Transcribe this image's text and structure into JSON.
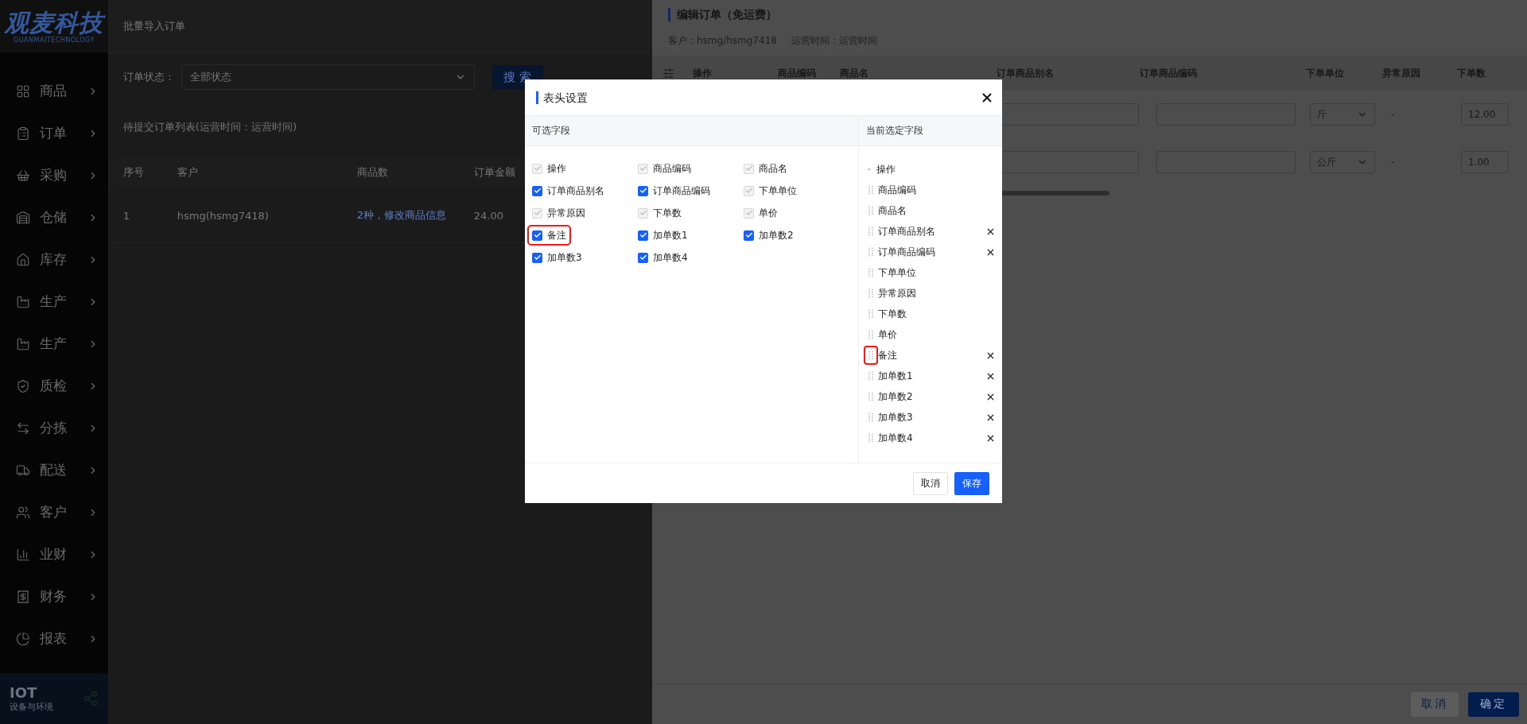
{
  "sidebar": {
    "logo": "观麦科技",
    "logo_sub": "GUANMAITECHNOLOGY",
    "items": [
      {
        "label": "商品"
      },
      {
        "label": "订单"
      },
      {
        "label": "采购"
      },
      {
        "label": "仓储"
      },
      {
        "label": "库存"
      },
      {
        "label": "生产"
      },
      {
        "label": "生产"
      },
      {
        "label": "质检"
      },
      {
        "label": "分拣"
      },
      {
        "label": "配送"
      },
      {
        "label": "客户"
      },
      {
        "label": "业财"
      },
      {
        "label": "财务"
      },
      {
        "label": "报表"
      }
    ],
    "promo": {
      "title": "IOT",
      "subtitle": "设备与环境"
    }
  },
  "page": {
    "title": "批量导入订单",
    "filter": {
      "label": "订单状态：",
      "value": "全部状态",
      "button": "搜 索"
    },
    "list_title": "待提交订单列表(运营时间：运营时间)",
    "table": {
      "columns": [
        "序号",
        "客户",
        "商品数",
        "订单金额"
      ],
      "rows": [
        {
          "index": "1",
          "customer": "hsmg(hsmg7418)",
          "items_link": "2种，修改商品信息",
          "amount": "24.00"
        }
      ]
    }
  },
  "drawer": {
    "title": "编辑订单（免运费）",
    "customer": "客户：hsmg/hsmg7418",
    "time": "运营时间：运营时间",
    "columns": [
      "操作",
      "商品编码",
      "商品名",
      "订单商品别名",
      "订单商品编码",
      "下单单位",
      "异常原因",
      "下单数"
    ],
    "rows": [
      {
        "unit": "斤",
        "reason": "-",
        "quantity": "12.00"
      },
      {
        "unit": "公斤",
        "reason": "-",
        "quantity": "1.00"
      }
    ],
    "buttons": [
      {
        "label": "取消",
        "kind": "secondary"
      },
      {
        "label": "确定",
        "kind": "primary"
      }
    ]
  },
  "modal": {
    "title": "表头设置",
    "available_title": "可选字段",
    "selected_title": "当前选定字段",
    "available": [
      {
        "label": "操作",
        "checked": true,
        "disabled": true,
        "highlighted": false
      },
      {
        "label": "商品编码",
        "checked": true,
        "disabled": true,
        "highlighted": false
      },
      {
        "label": "商品名",
        "checked": true,
        "disabled": true,
        "highlighted": false
      },
      {
        "label": "订单商品别名",
        "checked": true,
        "disabled": false,
        "highlighted": false
      },
      {
        "label": "订单商品编码",
        "checked": true,
        "disabled": false,
        "highlighted": false
      },
      {
        "label": "下单单位",
        "checked": true,
        "disabled": true,
        "highlighted": false
      },
      {
        "label": "异常原因",
        "checked": true,
        "disabled": true,
        "highlighted": false
      },
      {
        "label": "下单数",
        "checked": true,
        "disabled": true,
        "highlighted": false
      },
      {
        "label": "单价",
        "checked": true,
        "disabled": true,
        "highlighted": false
      },
      {
        "label": "备注",
        "checked": true,
        "disabled": false,
        "highlighted": true
      },
      {
        "label": "加单数1",
        "checked": true,
        "disabled": false,
        "highlighted": false
      },
      {
        "label": "加单数2",
        "checked": true,
        "disabled": false,
        "highlighted": false
      },
      {
        "label": "加单数3",
        "checked": true,
        "disabled": false,
        "highlighted": false
      },
      {
        "label": "加单数4",
        "checked": true,
        "disabled": false,
        "highlighted": false
      }
    ],
    "selected": [
      {
        "label": "操作",
        "draggable": false,
        "removable": false,
        "highlighted": false
      },
      {
        "label": "商品编码",
        "draggable": true,
        "removable": false,
        "highlighted": false
      },
      {
        "label": "商品名",
        "draggable": true,
        "removable": false,
        "highlighted": false
      },
      {
        "label": "订单商品别名",
        "draggable": true,
        "removable": true,
        "highlighted": false
      },
      {
        "label": "订单商品编码",
        "draggable": true,
        "removable": true,
        "highlighted": false
      },
      {
        "label": "下单单位",
        "draggable": true,
        "removable": false,
        "highlighted": false
      },
      {
        "label": "异常原因",
        "draggable": true,
        "removable": false,
        "highlighted": false
      },
      {
        "label": "下单数",
        "draggable": true,
        "removable": false,
        "highlighted": false
      },
      {
        "label": "单价",
        "draggable": true,
        "removable": false,
        "highlighted": false
      },
      {
        "label": "备注",
        "draggable": true,
        "removable": true,
        "highlighted": true
      },
      {
        "label": "加单数1",
        "draggable": true,
        "removable": true,
        "highlighted": false
      },
      {
        "label": "加单数2",
        "draggable": true,
        "removable": true,
        "highlighted": false
      },
      {
        "label": "加单数3",
        "draggable": true,
        "removable": true,
        "highlighted": false
      },
      {
        "label": "加单数4",
        "draggable": true,
        "removable": true,
        "highlighted": false
      }
    ],
    "buttons": [
      {
        "label": "取消",
        "kind": "secondary"
      },
      {
        "label": "保存",
        "kind": "primary"
      }
    ]
  }
}
